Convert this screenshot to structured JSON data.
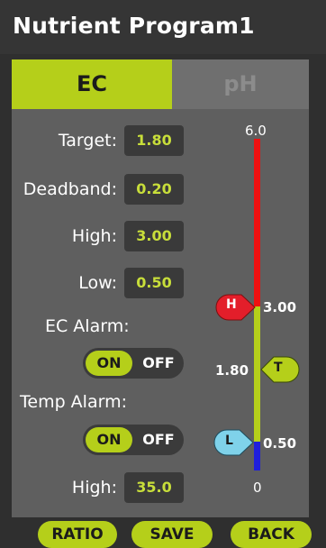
{
  "header": {
    "title": "Nutrient Program1"
  },
  "tabs": {
    "ec": "EC",
    "ph": "pH"
  },
  "settings": {
    "target": {
      "label": "Target:",
      "value": "1.80"
    },
    "deadband": {
      "label": "Deadband:",
      "value": "0.20"
    },
    "high": {
      "label": "High:",
      "value": "3.00"
    },
    "low": {
      "label": "Low:",
      "value": "0.50"
    },
    "ec_alarm": {
      "label": "EC Alarm:",
      "on": "ON",
      "off": "OFF"
    },
    "temp_alarm": {
      "label": "Temp Alarm:",
      "on": "ON",
      "off": "OFF"
    },
    "temp_high": {
      "label": "High:",
      "value": "35.0"
    }
  },
  "scale": {
    "max": "6.0",
    "min": "0",
    "high_marker": "H",
    "high_value": "3.00",
    "target_marker": "T",
    "target_value": "1.80",
    "low_marker": "L",
    "low_value": "0.50"
  },
  "buttons": {
    "ratio": "RATIO",
    "save": "SAVE",
    "back": "BACK"
  },
  "colors": {
    "accent": "#b5cf1a",
    "high_zone": "#ee1111",
    "normal_zone": "#b5cf1a",
    "low_zone": "#1f1fdd",
    "high_marker": "#e31e2a",
    "low_marker": "#7fd2ea"
  }
}
